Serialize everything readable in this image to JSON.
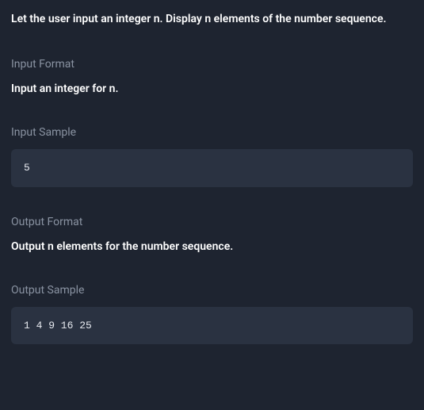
{
  "problem_statement": "Let the user input an integer n. Display n elements of the number sequence.",
  "input_format": {
    "label": "Input Format",
    "text": "Input an integer for n."
  },
  "input_sample": {
    "label": "Input Sample",
    "content": "5"
  },
  "output_format": {
    "label": "Output Format",
    "text": "Output n elements for the number sequence."
  },
  "output_sample": {
    "label": "Output Sample",
    "content": "1 4 9 16 25"
  }
}
